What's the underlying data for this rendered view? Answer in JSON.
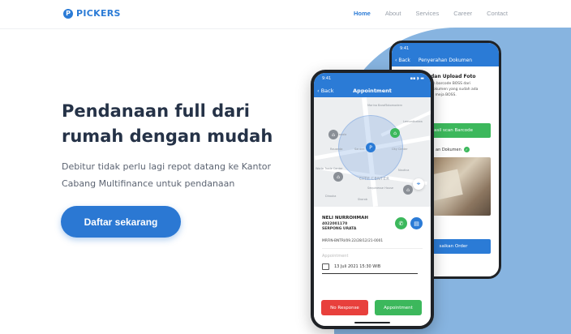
{
  "brand": {
    "name": "PICKERS",
    "logo_letter": "P",
    "color": "#2b7bd6"
  },
  "nav": {
    "items": [
      {
        "label": "Home",
        "active": true
      },
      {
        "label": "About",
        "active": false
      },
      {
        "label": "Services",
        "active": false
      },
      {
        "label": "Career",
        "active": false
      },
      {
        "label": "Contact",
        "active": false
      }
    ]
  },
  "hero": {
    "title": "Pendanaan full dari rumah dengan mudah",
    "subtitle": "Debitur tidak perlu lagi repot datang ke Kantor Cabang Multifinance untuk pendanaan",
    "cta_label": "Daftar sekarang"
  },
  "phone_back": {
    "time": "9:41",
    "back_label": "Back",
    "title": "Penyerahan Dokumen",
    "heading": "dan Upload Foto",
    "body_text": "an barcode BOSS dari dokumen yang sudah ada di meja BOSS.",
    "scan_button": "asil scan Barcode",
    "doc_label": "an Dokumen",
    "finish_button": "saikan Order"
  },
  "phone_front": {
    "time": "9:41",
    "back_label": "Back",
    "title": "Appointment",
    "map": {
      "city_label": "CITY CENTER",
      "labels": [
        "Marina Barat",
        "Tokomodern",
        "Lemonthekea",
        "Kiranola",
        "Rauanda",
        "Santrel",
        "World Trade Center",
        "Sequinesse House",
        "City Center",
        "Skorob",
        "Dirooka",
        "Nautica"
      ]
    },
    "customer": {
      "name": "NELI NURROHMAH",
      "id": "4022001170",
      "city": "SERPONG URATA",
      "ref": "MRFIN-BNTRI/09.22/28/12/21-0001"
    },
    "appointment_label": "Appointment",
    "appointment_date": "13 Juli 2021 15:30 WIB",
    "no_response_label": "No Response",
    "appointment_button": "Appointment"
  },
  "colors": {
    "accent": "#2b7bd6",
    "green": "#3cb85c",
    "red": "#e8403c",
    "blob": "#87b4e0"
  }
}
